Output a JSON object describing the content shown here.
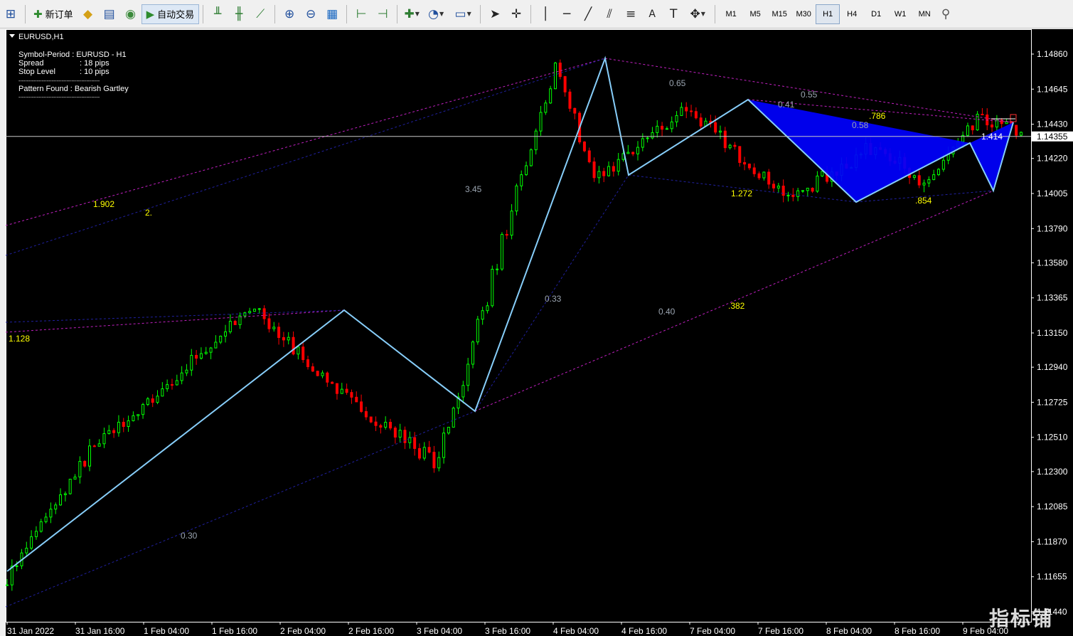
{
  "toolbar": {
    "new_order": "新订单",
    "auto_trading": "自动交易",
    "timeframes": [
      "M1",
      "M5",
      "M15",
      "M30",
      "H1",
      "H4",
      "D1",
      "W1",
      "MN"
    ],
    "active_timeframe": "H1"
  },
  "chart": {
    "symbol_title": "EURUSD,H1",
    "info": {
      "symbol_period": "Symbol-Period : EURUSD - H1",
      "spread_label": "Spread",
      "spread_value": ": 18 pips",
      "stop_label": "Stop Level",
      "stop_value": ": 10 pips",
      "divider": "-------------------------------------------------",
      "pattern_found": "Pattern Found  : Bearish Gartley"
    },
    "price_axis": [
      "1.14860",
      "1.14645",
      "1.14430",
      "1.14220",
      "1.14005",
      "1.13790",
      "1.13580",
      "1.13365",
      "1.13150",
      "1.12940",
      "1.12725",
      "1.12510",
      "1.12300",
      "1.12085",
      "1.11870",
      "1.11655",
      "1.11440"
    ],
    "current_price": "1.14355",
    "time_axis": [
      "31 Jan 2022",
      "31 Jan 16:00",
      "1 Feb 04:00",
      "1 Feb 16:00",
      "2 Feb 04:00",
      "2 Feb 16:00",
      "3 Feb 04:00",
      "3 Feb 16:00",
      "4 Feb 04:00",
      "4 Feb 16:00",
      "7 Feb 04:00",
      "7 Feb 16:00",
      "8 Feb 04:00",
      "8 Feb 16:00",
      "9 Feb 04:00"
    ],
    "ratio_labels": [
      {
        "text": "1.902",
        "color": "#ffff00"
      },
      {
        "text": "2.",
        "color": "#ffff00"
      },
      {
        "text": "1.128",
        "color": "#ffff00"
      },
      {
        "text": "3.45",
        "color": "#9aa4b0"
      },
      {
        "text": "0.33",
        "color": "#9aa4b0"
      },
      {
        "text": "0.30",
        "color": "#9aa4b0"
      },
      {
        "text": "0.65",
        "color": "#9aa4b0"
      },
      {
        "text": "0.55",
        "color": "#9aa4b0"
      },
      {
        "text": "0.41",
        "color": "#9aa4b0"
      },
      {
        "text": "0.58",
        "color": "#9aa4b0"
      },
      {
        "text": ".786",
        "color": "#ffff00"
      },
      {
        "text": "1.272",
        "color": "#ffff00"
      },
      {
        "text": ".854",
        "color": "#ffff00"
      },
      {
        "text": "0.40",
        "color": "#9aa4b0"
      },
      {
        "text": ".382",
        "color": "#ffff00"
      },
      {
        "text": "1.414",
        "color": "#ffffff"
      }
    ],
    "colors": {
      "background": "#000000",
      "bull_candle": "#00ff00",
      "bear_candle": "#ff0000",
      "zigzag": "#87cefa",
      "pattern_fill": "#0000ff",
      "fib_lines": "#c020c0",
      "ratio_lines": "#2020a0",
      "axis_text": "#ffffff"
    },
    "watermark": "指标铺"
  }
}
